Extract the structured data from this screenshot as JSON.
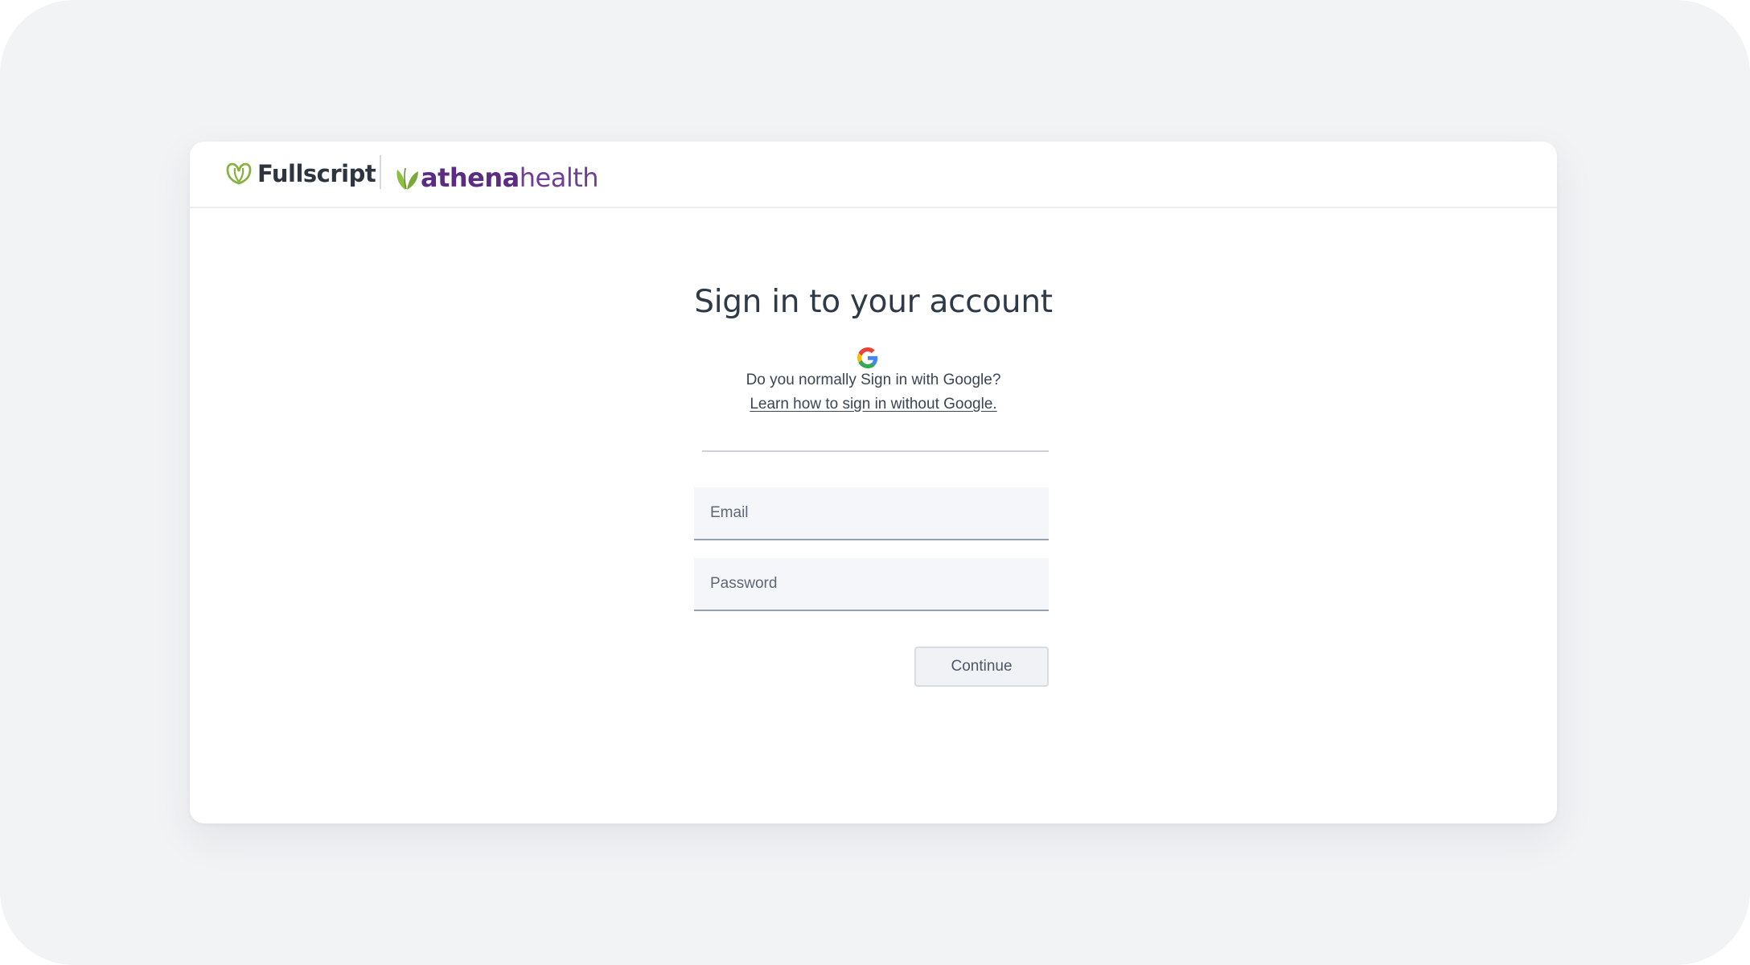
{
  "header": {
    "fullscript_logo_text": "Fullscript",
    "athena_logo_bold": "athena",
    "athena_logo_light": "health"
  },
  "login": {
    "title": "Sign in to your account",
    "google_icon": "google-g-icon",
    "google_question": "Do you normally Sign in with Google?",
    "google_help_link": "Learn how to sign in without Google.",
    "email_placeholder": "Email",
    "password_placeholder": "Password",
    "continue_label": "Continue"
  },
  "colors": {
    "background": "#f2f3f5",
    "card": "#ffffff",
    "text_primary": "#2f3a48",
    "fullscript_green": "#86b340",
    "athena_purple": "#5b2d82"
  }
}
